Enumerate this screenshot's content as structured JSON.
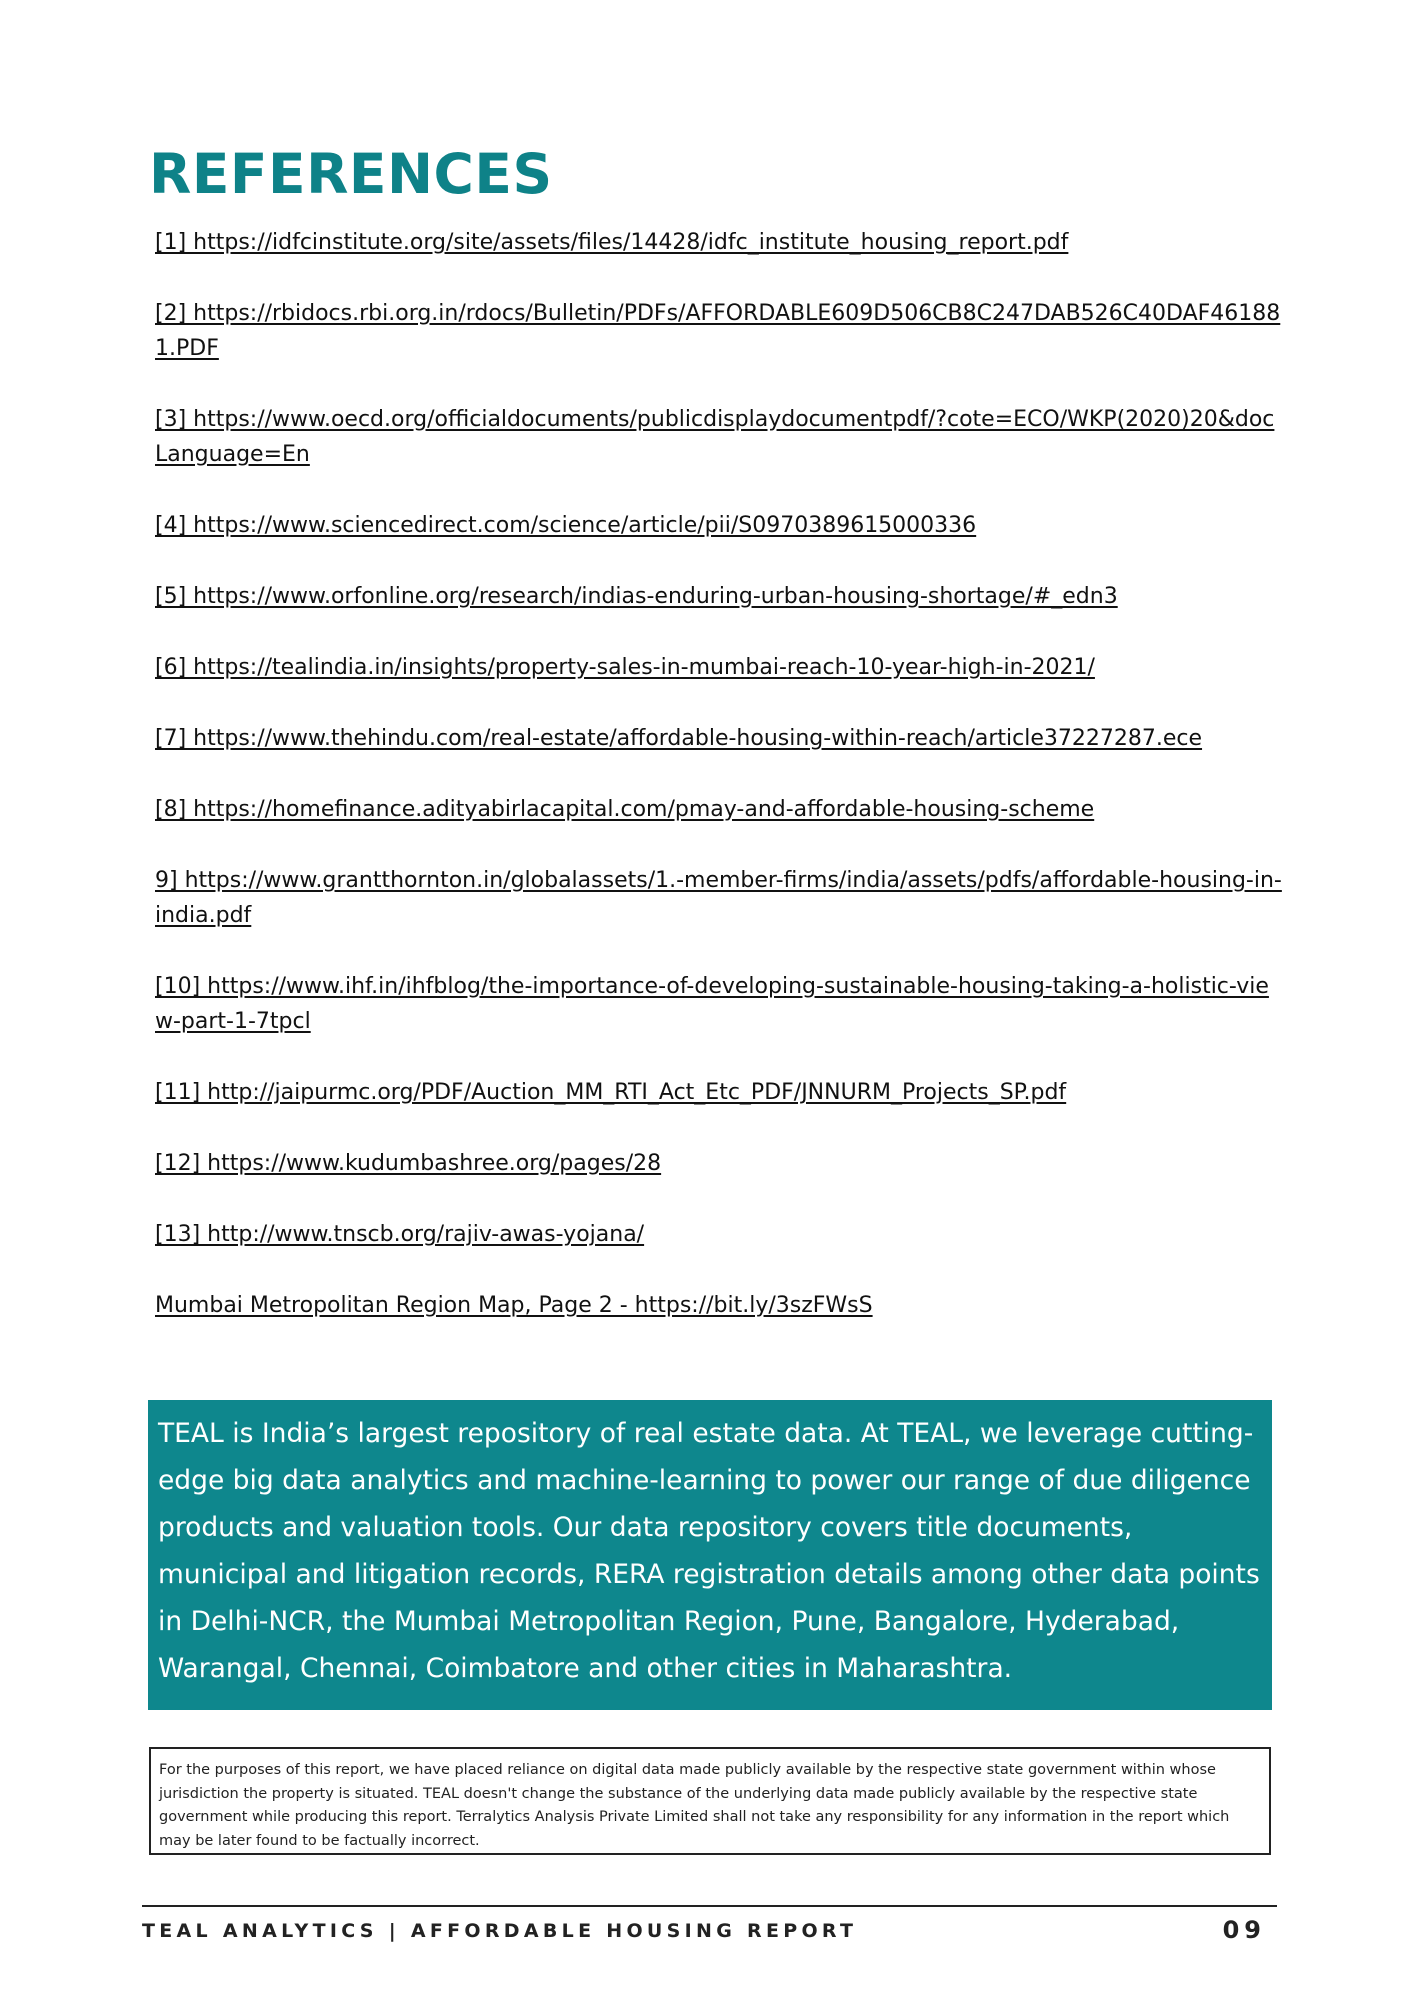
{
  "title": "REFERENCES",
  "references": [
    "[1] https://idfcinstitute.org/site/assets/files/14428/idfc_institute_housing_report.pdf",
    "[2] https://rbidocs.rbi.org.in/rdocs/Bulletin/PDFs/AFFORDABLE609D506CB8C247DAB526C40DAF461881.PDF",
    "[3] https://www.oecd.org/officialdocuments/publicdisplaydocumentpdf/?cote=ECO/WKP(2020)20&docLanguage=En",
    "[4] https://www.sciencedirect.com/science/article/pii/S0970389615000336",
    "[5] https://www.orfonline.org/research/indias-enduring-urban-housing-shortage/#_edn3",
    "[6] https://tealindia.in/insights/property-sales-in-mumbai-reach-10-year-high-in-2021/",
    "[7] https://www.thehindu.com/real-estate/affordable-housing-within-reach/article37227287.ece",
    "[8] https://homefinance.adityabirlacapital.com/pmay-and-affordable-housing-scheme",
    "9] https://www.grantthornton.in/globalassets/1.-member-firms/india/assets/pdfs/affordable-housing-in-india.pdf",
    "[10] https://www.ihf.in/ihfblog/the-importance-of-developing-sustainable-housing-taking-a-holistic-view-part-1-7tpcl",
    "[11] http://jaipurmc.org/PDF/Auction_MM_RTI_Act_Etc_PDF/JNNURM_Projects_SP.pdf",
    "[12] https://www.kudumbashree.org/pages/28",
    "[13] http://www.tnscb.org/rajiv-awas-yojana/",
    "Mumbai Metropolitan Region Map, Page 2 - https://bit.ly/3szFWsS"
  ],
  "about": "TEAL is India’s largest repository of real estate data. At TEAL, we leverage cutting-edge big data analytics and machine-learning to power our range of due diligence products and valuation tools. Our data repository covers title documents, municipal and litigation records, RERA registration details among other data points in Delhi-NCR, the Mumbai Metropolitan Region, Pune, Bangalore, Hyderabad, Warangal, Chennai, Coimbatore and other cities in Maharashtra.",
  "disclaimer": "For the purposes of this report, we have placed reliance on digital data made publicly available by the respective state government within whose jurisdiction the property is situated. TEAL doesn't change the substance of the underlying data made publicly available by the respective state government while producing this report. Terralytics Analysis Private Limited shall not take any responsibility for any information in the report which may be later found to be factually incorrect.",
  "footer": {
    "left": "TEAL ANALYTICS | AFFORDABLE HOUSING REPORT",
    "page_number": "09"
  },
  "colors": {
    "accent": "#0e8288",
    "about_background": "#0e878d"
  }
}
